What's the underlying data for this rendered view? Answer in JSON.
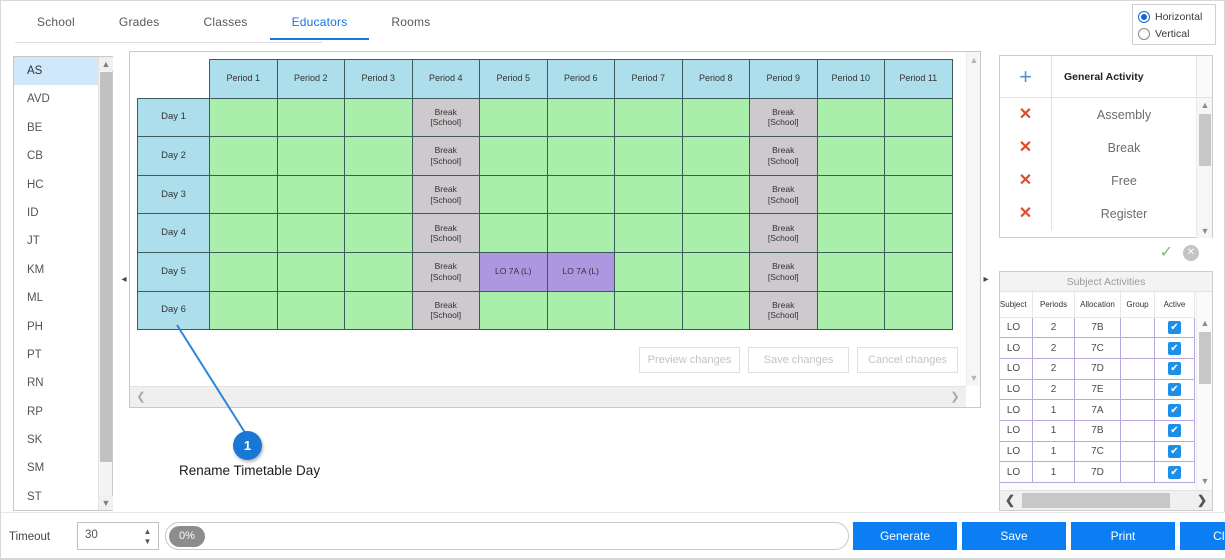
{
  "tabs": [
    {
      "label": "School",
      "active": false
    },
    {
      "label": "Grades",
      "active": false
    },
    {
      "label": "Classes",
      "active": false
    },
    {
      "label": "Educators",
      "active": true
    },
    {
      "label": "Rooms",
      "active": false
    }
  ],
  "orientation": {
    "horizontal_label": "Horizontal",
    "vertical_label": "Vertical",
    "selected": "Horizontal"
  },
  "educators": {
    "selected": "AS",
    "items": [
      "AS",
      "AVD",
      "BE",
      "CB",
      "HC",
      "ID",
      "JT",
      "KM",
      "ML",
      "PH",
      "PT",
      "RN",
      "RP",
      "SK",
      "SM",
      "ST"
    ]
  },
  "timetable": {
    "periods": [
      "Period 1",
      "Period 2",
      "Period 3",
      "Period 4",
      "Period 5",
      "Period 6",
      "Period 7",
      "Period 8",
      "Period 9",
      "Period 10",
      "Period 11"
    ],
    "days": [
      "Day 1",
      "Day 2",
      "Day 3",
      "Day 4",
      "Day 5",
      "Day 6"
    ],
    "break_label_line1": "Break",
    "break_label_line2": "[School]",
    "lesson_label": "LO 7A (L)",
    "rows": [
      {
        "day": "Day 1",
        "cells": [
          "free",
          "free",
          "free",
          "break",
          "free",
          "free",
          "free",
          "free",
          "break",
          "free",
          "free"
        ]
      },
      {
        "day": "Day 2",
        "cells": [
          "free",
          "free",
          "free",
          "break",
          "free",
          "free",
          "free",
          "free",
          "break",
          "free",
          "free"
        ]
      },
      {
        "day": "Day 3",
        "cells": [
          "free",
          "free",
          "free",
          "break",
          "free",
          "free",
          "free",
          "free",
          "break",
          "free",
          "free"
        ]
      },
      {
        "day": "Day 4",
        "cells": [
          "free",
          "free",
          "free",
          "break",
          "free",
          "free",
          "free",
          "free",
          "break",
          "free",
          "free"
        ]
      },
      {
        "day": "Day 5",
        "cells": [
          "free",
          "free",
          "free",
          "break",
          "lesson",
          "lesson",
          "free",
          "free",
          "break",
          "free",
          "free"
        ]
      },
      {
        "day": "Day 6",
        "cells": [
          "free",
          "free",
          "free",
          "break",
          "free",
          "free",
          "free",
          "free",
          "break",
          "free",
          "free"
        ]
      }
    ]
  },
  "change_buttons": {
    "preview": "Preview changes",
    "save": "Save changes",
    "cancel": "Cancel changes"
  },
  "general_activity": {
    "title": "General Activity",
    "add_symbol": "+",
    "items": [
      "Assembly",
      "Break",
      "Free",
      "Register"
    ]
  },
  "subject_activities": {
    "title": "Subject Activities",
    "columns": [
      "Subject",
      "Periods",
      "Allocation",
      "Group",
      "Active"
    ],
    "rows": [
      {
        "subject": "LO",
        "periods": "2",
        "allocation": "7B",
        "group": "",
        "active": true
      },
      {
        "subject": "LO",
        "periods": "2",
        "allocation": "7C",
        "group": "",
        "active": true
      },
      {
        "subject": "LO",
        "periods": "2",
        "allocation": "7D",
        "group": "",
        "active": true
      },
      {
        "subject": "LO",
        "periods": "2",
        "allocation": "7E",
        "group": "",
        "active": true
      },
      {
        "subject": "LO",
        "periods": "1",
        "allocation": "7A",
        "group": "",
        "active": true
      },
      {
        "subject": "LO",
        "periods": "1",
        "allocation": "7B",
        "group": "",
        "active": true
      },
      {
        "subject": "LO",
        "periods": "1",
        "allocation": "7C",
        "group": "",
        "active": true
      },
      {
        "subject": "LO",
        "periods": "1",
        "allocation": "7D",
        "group": "",
        "active": true
      }
    ]
  },
  "annotation": {
    "number": "1",
    "text": "Rename Timetable Day"
  },
  "bottom": {
    "timeout_label": "Timeout",
    "timeout_value": "30",
    "progress_text": "0%",
    "generate": "Generate",
    "save": "Save",
    "print": "Print",
    "clear_all": "Clear All"
  },
  "colors": {
    "accent": "#1a73e8",
    "button_blue": "#0b7ef4",
    "header_cell": "#addeeb",
    "free_cell": "#a9eeab",
    "break_cell": "#cdc9cd",
    "lesson_cell": "#ae96e0",
    "delete_x": "#e04b2a",
    "checkbox": "#1c90e8"
  }
}
